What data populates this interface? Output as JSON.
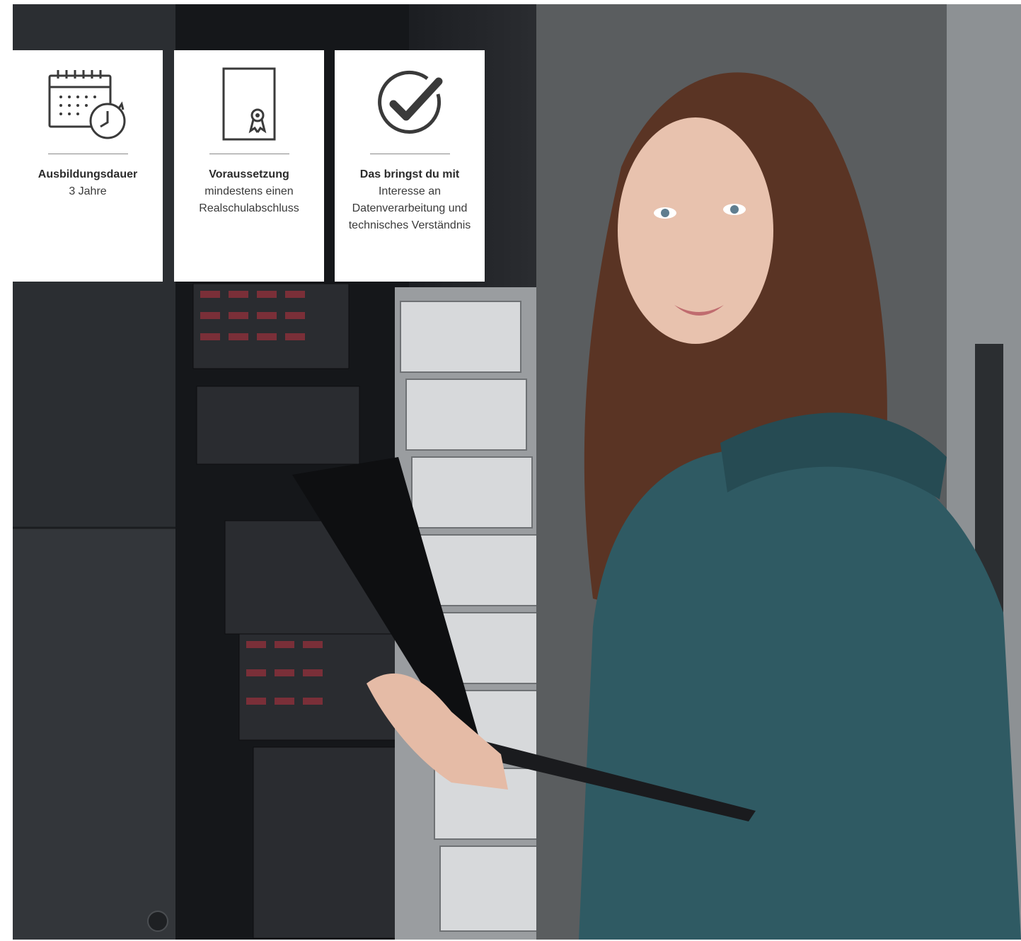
{
  "cards": [
    {
      "icon": "calendar-clock-icon",
      "title": "Ausbildungsdauer",
      "description": "3 Jahre"
    },
    {
      "icon": "certificate-icon",
      "title": "Voraussetzung",
      "description": "mindestens einen Realschulabschluss"
    },
    {
      "icon": "check-circle-icon",
      "title": "Das bringst du mit",
      "description": "Interesse an Datenverarbeitung und technisches Verständnis"
    }
  ],
  "colors": {
    "card_background": "#ffffff",
    "icon_stroke": "#3a3a3a",
    "hoodie": "#2f5a63"
  }
}
